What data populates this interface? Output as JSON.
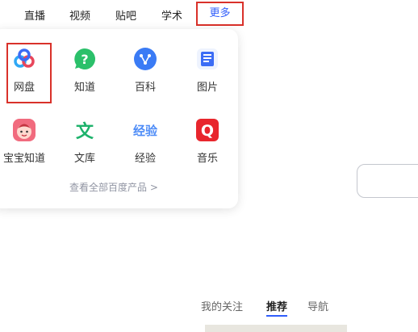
{
  "nav": {
    "items": [
      {
        "label": "直播"
      },
      {
        "label": "视频"
      },
      {
        "label": "贴吧"
      },
      {
        "label": "学术"
      }
    ],
    "more": {
      "label": "更多",
      "color": "#315efb"
    }
  },
  "dropdown": {
    "apps": [
      {
        "label": "网盘",
        "icon": "cloud-icon"
      },
      {
        "label": "知道",
        "icon": "question-icon"
      },
      {
        "label": "百科",
        "icon": "baike-icon"
      },
      {
        "label": "图片",
        "icon": "image-icon"
      },
      {
        "label": "宝宝知道",
        "icon": "baby-icon"
      },
      {
        "label": "文库",
        "icon": "wenku-icon",
        "glyph": "文"
      },
      {
        "label": "经验",
        "icon": "jingyan-icon",
        "glyph": "经验"
      },
      {
        "label": "音乐",
        "icon": "music-icon",
        "glyph": "Q"
      }
    ],
    "view_all": "查看全部百度产品 >"
  },
  "feed_tabs": [
    {
      "label": "我的关注"
    },
    {
      "label": "推荐",
      "active": true
    },
    {
      "label": "导航"
    }
  ],
  "colors": {
    "accent": "#315efb",
    "highlight": "#d9312a"
  }
}
